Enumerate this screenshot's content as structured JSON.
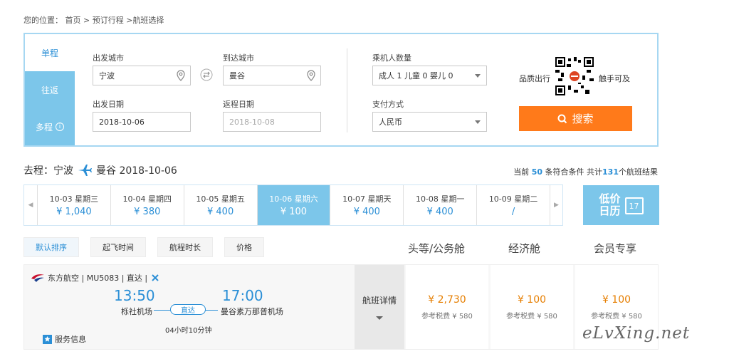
{
  "breadcrumb": {
    "prefix": "您的位置：",
    "home": "首页",
    "sep1": " > ",
    "booking": "预订行程",
    "sep2": " >",
    "current": "航班选择"
  },
  "search": {
    "tabs": [
      "单程",
      "往返",
      "多程"
    ],
    "from_label": "出发城市",
    "from_value": "宁波",
    "to_label": "到达城市",
    "to_value": "曼谷",
    "depart_label": "出发日期",
    "depart_value": "2018-10-06",
    "return_label": "返程日期",
    "return_placeholder": "2018-10-08",
    "passengers_label": "乘机人数量",
    "passengers_value": "成人 1  儿童 0  婴儿 0",
    "payment_label": "支付方式",
    "payment_value": "人民币",
    "promo_left": "品质出行",
    "promo_right": "触手可及",
    "search_button": "搜索"
  },
  "trip": {
    "prefix": "去程：宁波",
    "dest": "曼谷 2018-10-06"
  },
  "summary": {
    "pre": "当前 ",
    "count": "50",
    "mid": " 条符合条件 共计",
    "total": "131",
    "post": "个航班结果"
  },
  "dates": [
    {
      "date": "10-03 星期三",
      "price": "¥ 1,040"
    },
    {
      "date": "10-04 星期四",
      "price": "¥ 380"
    },
    {
      "date": "10-05 星期五",
      "price": "¥ 400"
    },
    {
      "date": "10-06 星期六",
      "price": "¥ 100",
      "active": true
    },
    {
      "date": "10-07 星期天",
      "price": "¥ 400"
    },
    {
      "date": "10-08 星期一",
      "price": "¥ 400"
    },
    {
      "date": "10-09 星期二",
      "price": "/"
    }
  ],
  "lowcal": {
    "line1": "低价",
    "line2": "日历",
    "day": "17"
  },
  "sort": [
    "默认排序",
    "起飞时间",
    "航程时长",
    "价格"
  ],
  "cabins": [
    "头等/公务舱",
    "经济舱",
    "会员专享"
  ],
  "flight": {
    "airline": "东方航空 | MU5083 | 直达 |",
    "dep_time": "13:50",
    "dep_airport": "栎社机场",
    "arr_time": "17:00",
    "arr_airport": "曼谷素万那普机场",
    "direct": "直达",
    "duration": "04小时10分钟",
    "service": "服务信息",
    "detail": "航班详情",
    "prices": [
      {
        "price": "¥ 2,730",
        "tax": "参考税费 ¥ 580"
      },
      {
        "price": "¥ 100",
        "tax": "参考税费 ¥ 580"
      },
      {
        "price": "¥ 100",
        "tax": "参考税费 ¥ 580"
      }
    ]
  },
  "watermark": "eLvXing.net",
  "colors": {
    "accent": "#2b8fd6",
    "tab": "#7cc6ea",
    "search": "#ff7a1a",
    "price": "#e67e00"
  }
}
